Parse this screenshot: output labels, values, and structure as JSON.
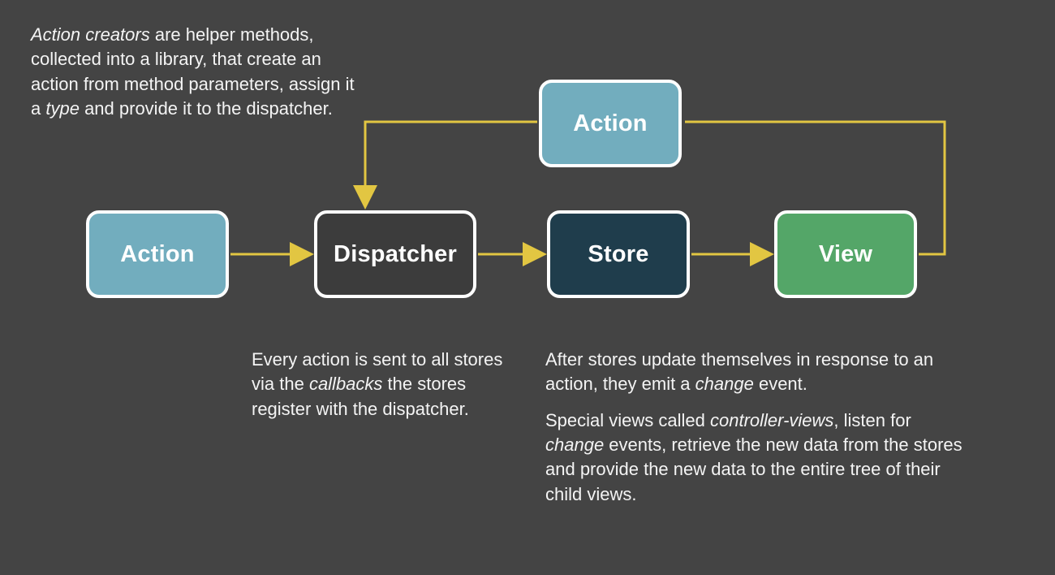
{
  "diagram": {
    "nodes": {
      "action_left": {
        "label": "Action"
      },
      "dispatcher": {
        "label": "Dispatcher"
      },
      "store": {
        "label": "Store"
      },
      "view": {
        "label": "View"
      },
      "action_top": {
        "label": "Action"
      }
    },
    "colors": {
      "action": "#72adbe",
      "dispatcher": "#3c3c3c",
      "store": "#1f3d4c",
      "view": "#54a668",
      "arrow": "#e2c642",
      "background": "#444444",
      "border": "#ffffff"
    },
    "captions": {
      "top_left_html": "<em>Action creators</em> are helper methods, collected into a library, that create an action from method parameters, assign it a <em>type</em> and provide it to the dispatcher.",
      "bottom_left_html": "Every action is sent to all stores via the <em>callbacks</em> the stores register with the dispatcher.",
      "bottom_right_p1_html": "After stores update themselves in response to an action, they emit a <em>change</em> event.",
      "bottom_right_p2_html": "Special views called <em>controller-views</em>, listen for <em>change</em> events, retrieve the new data from the stores and provide the new data to the entire tree of their child views."
    },
    "flow": [
      [
        "action_left",
        "dispatcher"
      ],
      [
        "dispatcher",
        "store"
      ],
      [
        "store",
        "view"
      ],
      [
        "view",
        "action_top"
      ],
      [
        "action_top",
        "dispatcher"
      ]
    ]
  }
}
